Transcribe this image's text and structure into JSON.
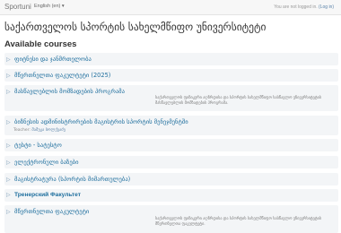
{
  "navbar": {
    "brand": "Sportuni",
    "language": "English (en) ▾",
    "login_text": "You are not logged in.",
    "login_link": "(Log in)"
  },
  "page_title": "საქართველოს სპორტის სახელმწიფო უნივერსიტეტი",
  "section_title": "Available courses",
  "courses": [
    {
      "name": "ფიტნესი და ჯანმრთელობა"
    },
    {
      "name": "მწვრთნელთა ფაკულტეტი (2025)"
    },
    {
      "name": "მასწავლებლის მომზადების პროგრამა",
      "summary": "საქართველოს ფიზიკური აღზრდისა და სპორტის სახელმწიფო სასწავლო უნივერსიტეტის მასწავლებლის მომზადების პროგრამა."
    },
    {
      "name": "ბიზნესის ადმინისტრირების მაგისტრის სპორტის მენეჯმენტში",
      "teacher_label": "Teacher:",
      "teacher_name": "მამუკა ბოლქვაძე"
    },
    {
      "name": "ტესტი - სატესტო"
    },
    {
      "name": "ელექტრონული ბაზები"
    },
    {
      "name": "მაგისტრატურა (სპორტის მიმართულება)"
    },
    {
      "name": "Тренерский Факультет"
    },
    {
      "name": "მწვრთნელთა ფაკულტეტი",
      "summary": "საქართველოს ფიზიკური აღზრდისა და სპორტის სახელმწიფო სასწავლო უნივერსიტეტის მწვრთნელთა ფაკულტეტი."
    }
  ]
}
